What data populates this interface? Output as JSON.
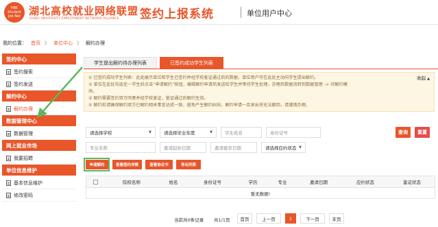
{
  "header": {
    "logo_text": "HBE Student Job Net",
    "brand_cn": "湖北高校就业网络联盟",
    "brand_en": "HUBEI UNIVERSITY EMPLOYMENT NETWORK ALLIANCE",
    "system_title": "签约上报系统",
    "system_sub": "单位用户中心"
  },
  "breadcrumb": {
    "label": "我的位置：",
    "items": [
      "首页",
      "单位中心",
      "解约办理"
    ],
    "separator": "》"
  },
  "sidebar": {
    "groups": [
      {
        "title": "签约中心",
        "items": [
          "签约搜索",
          "签约发送"
        ]
      },
      {
        "title": "解约中心",
        "items": [
          "解约办理"
        ]
      },
      {
        "title": "数据管理中心",
        "items": [
          "数据管理"
        ]
      },
      {
        "title": "网上就业市场",
        "items": [
          "我要招聘"
        ]
      },
      {
        "title": "单位信息维护",
        "items": [
          "基本信息维护",
          "修改密码"
        ]
      }
    ],
    "active_item": "解约办理"
  },
  "tabs": [
    "学生提出解约待办理列表",
    "已签约成功学生列表"
  ],
  "active_tab": 1,
  "notice": {
    "collapse_label": "收起",
    "lines": [
      "① 已签约成功学生列表：此处展示单位和学生已签约并经学校鉴证通过后的数据，单位用户可在此处主动向学生提出解约。",
      "② 单位在此处勾选任一学生后点击“申请解约”按钮，编辑解约申请后发送给学生并等待学生处理，办理后数据流转到数据管理 -> 待解约模",
      "块。",
      "③ 解约需要签约双方同意并经学校鉴证，鉴证通过后解约生效。",
      "④ 解约前请确保解约双方已解约相关事宜达成一致，避免产生解约纠纷。解约申请一旦发出将无法撤回，请谨慎办理。"
    ]
  },
  "filters": {
    "school_select": "请选择学校",
    "year_select": "请选择毕业年度",
    "student_name_ph": "学生姓名",
    "id_ph": "身份证号",
    "major_ph": "专业名称",
    "invite_start_ph": "邀请起始日期",
    "invite_end_ph": "邀请截至日期",
    "status_select": "请选择应约状态",
    "search_label": "查询",
    "reset_label": "重置"
  },
  "actions": [
    "申请解约",
    "查看签约详情",
    "查看协议书",
    "导出列表"
  ],
  "table": {
    "columns": [
      "院校名称",
      "姓名",
      "身份证号",
      "学历",
      "专业",
      "邀请日期",
      "应约状态",
      "鉴证状态"
    ],
    "empty_text": "暂无数据!"
  },
  "pager": {
    "summary": "当前共0条记录",
    "pages": "共1/1页",
    "first": "首页",
    "prev": "上一页",
    "current": "1",
    "next": "下一页",
    "last": "末页"
  },
  "colors": {
    "accent": "#e8562a",
    "reset": "#e84b4b",
    "highlight": "#5cb85c"
  }
}
